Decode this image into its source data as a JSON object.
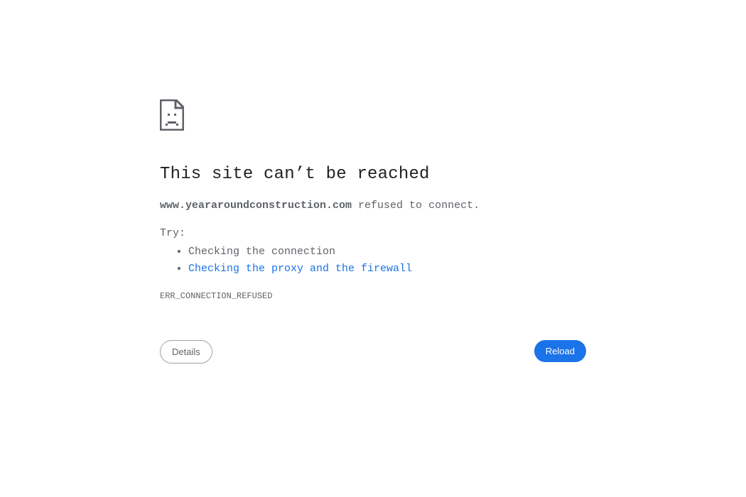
{
  "error_page": {
    "icon": "sad-page-icon",
    "title": "This site can’t be reached",
    "host": "www.yeararoundconstruction.com",
    "summary_suffix": " refused to connect.",
    "try_label": "Try:",
    "suggestions": [
      {
        "text": "Checking the connection",
        "link": false
      },
      {
        "text": "Checking the proxy and the firewall",
        "link": true
      }
    ],
    "error_code": "ERR_CONNECTION_REFUSED"
  },
  "buttons": {
    "details_label": "Details",
    "reload_label": "Reload"
  },
  "colors": {
    "background": "#ffffff",
    "title": "#202124",
    "text": "#5f6368",
    "link": "#1a73e8",
    "primary_button": "#1a73e8"
  }
}
